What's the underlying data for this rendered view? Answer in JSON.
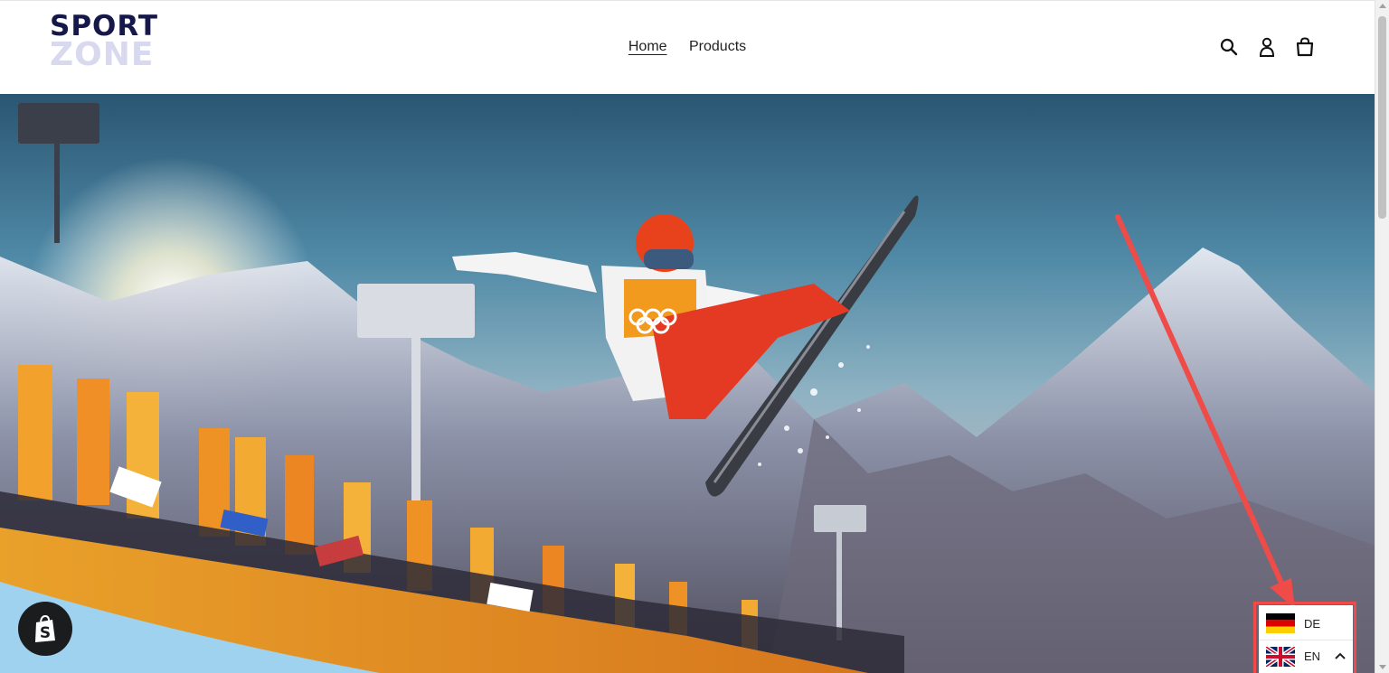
{
  "logo": {
    "line1": "SPORT",
    "line2": "ZONE"
  },
  "nav": {
    "items": [
      {
        "label": "Home",
        "active": true
      },
      {
        "label": "Products",
        "active": false
      }
    ]
  },
  "header_icons": [
    "search-icon",
    "account-icon",
    "cart-icon"
  ],
  "language_switcher": {
    "options": [
      {
        "code": "DE",
        "flag": "germany-flag-icon"
      },
      {
        "code": "EN",
        "flag": "uk-flag-icon"
      }
    ],
    "selected": "EN",
    "highlight_color": "#ef4b48"
  },
  "colors": {
    "logo_dark": "#16184a",
    "logo_light": "#d8d9ee",
    "annotation": "#ef4b48",
    "badge": "#1b1c1e"
  }
}
